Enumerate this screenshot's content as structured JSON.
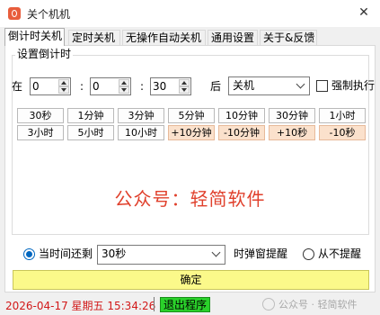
{
  "window": {
    "title": "关个机机",
    "close_glyph": "✕",
    "app_color": "#e85d3c"
  },
  "tabs": [
    {
      "label": "倒计时关机"
    },
    {
      "label": "定时关机"
    },
    {
      "label": "无操作自动关机"
    },
    {
      "label": "通用设置"
    },
    {
      "label": "关于&反馈"
    }
  ],
  "group_label": "设置倒计时",
  "countdown": {
    "prefix": "在",
    "hours": "0",
    "colon1": ":",
    "minutes": "0",
    "colon2": ":",
    "seconds": "30",
    "after": "后",
    "action": "关机",
    "force_label": "强制执行",
    "force_checked": false
  },
  "quick_buttons_row1": [
    "30秒",
    "1分钟",
    "3分钟",
    "5分钟",
    "10分钟",
    "30分钟",
    "1小时"
  ],
  "quick_buttons_row2": [
    "3小时",
    "5小时",
    "10小时",
    "+10分钟",
    "-10分钟",
    "+10秒",
    "-10秒"
  ],
  "watermark_text": "公众号：轻简软件",
  "remind": {
    "when_remaining_label": "当时间还剩",
    "remaining_value": "30秒",
    "popup_label": "时弹窗提醒",
    "no_remind_label": "从不提醒",
    "selected": "when_remaining"
  },
  "confirm_label": "确定",
  "status": {
    "datetime": "2026-04-17 星期五 15:34:26",
    "exit_label": "退出程序",
    "watermark": "公众号 · 轻简软件"
  },
  "colors": {
    "confirm_bg": "#fbf98a",
    "exit_bg": "#2ad12a",
    "datetime": "#d21919",
    "warm_button": "#fbe1cc"
  }
}
